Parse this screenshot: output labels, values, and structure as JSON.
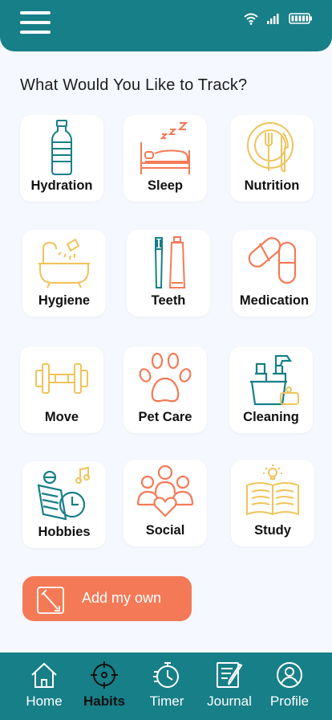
{
  "header": {
    "menu_icon": "hamburger-menu-icon",
    "status_icons": [
      "wifi-icon",
      "signal-icon",
      "battery-icon"
    ]
  },
  "heading": "What Would You Like to Track?",
  "categories": [
    {
      "label": "Hydration",
      "icon": "water-bottle-icon"
    },
    {
      "label": "Sleep",
      "icon": "bed-sleep-icon"
    },
    {
      "label": "Nutrition",
      "icon": "plate-fork-knife-icon"
    },
    {
      "label": "Hygiene",
      "icon": "bathtub-shower-icon"
    },
    {
      "label": "Teeth",
      "icon": "toothbrush-toothpaste-icon"
    },
    {
      "label": "Medication",
      "icon": "pill-capsule-icon"
    },
    {
      "label": "Move",
      "icon": "dumbbell-icon"
    },
    {
      "label": "Pet Care",
      "icon": "paw-print-icon"
    },
    {
      "label": "Cleaning",
      "icon": "cleaning-supplies-icon"
    },
    {
      "label": "Hobbies",
      "icon": "book-music-clock-icon"
    },
    {
      "label": "Social",
      "icon": "people-heart-icon"
    },
    {
      "label": "Study",
      "icon": "open-book-lightbulb-icon"
    }
  ],
  "add_button": {
    "label": "Add my own",
    "icon": "edit-note-icon"
  },
  "nav": {
    "items": [
      {
        "label": "Home",
        "icon": "home-icon",
        "active": false
      },
      {
        "label": "Habits",
        "icon": "target-icon",
        "active": true
      },
      {
        "label": "Timer",
        "icon": "stopwatch-icon",
        "active": false
      },
      {
        "label": "Journal",
        "icon": "journal-pen-icon",
        "active": false
      },
      {
        "label": "Profile",
        "icon": "user-profile-icon",
        "active": false
      }
    ]
  },
  "colors": {
    "primary": "#177f87",
    "accent_orange": "#f47a57",
    "accent_yellow": "#f0c35a",
    "background": "#f5f8ff"
  }
}
